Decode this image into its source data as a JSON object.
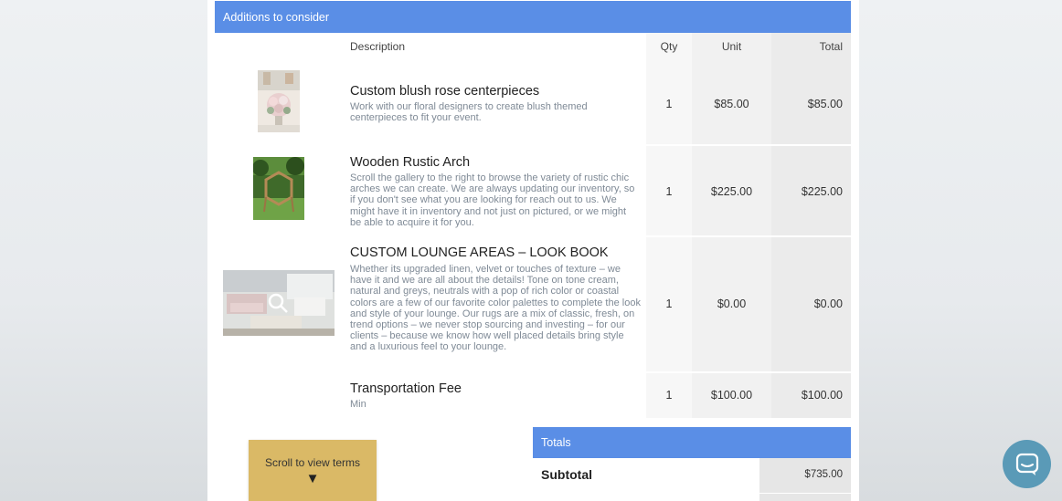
{
  "section": {
    "title": "Additions to consider"
  },
  "columns": {
    "description": "Description",
    "qty": "Qty",
    "unit": "Unit",
    "total": "Total"
  },
  "items": [
    {
      "thumbnail": "floral-centerpiece-photo",
      "title": "Custom blush rose centerpieces",
      "description": "Work with our floral designers to create blush themed centerpieces to fit your event.",
      "qty": "1",
      "unit": "$85.00",
      "total": "$85.00"
    },
    {
      "thumbnail": "wooden-arch-photo",
      "title": "Wooden Rustic Arch",
      "description": "Scroll the gallery to the right to browse the variety of rustic chic arches we can create. We are always updating our inventory, so if you don't see what you are looking for reach out to us. We might have it in inventory and not just on pictured, or we might be able to acquire it for you.",
      "qty": "1",
      "unit": "$225.00",
      "total": "$225.00"
    },
    {
      "thumbnail": "lounge-area-photo",
      "title": "CUSTOM LOUNGE AREAS – LOOK BOOK",
      "description": "Whether its upgraded linen, velvet or touches of texture – we have it and we are all about the details! Tone on tone cream, natural and greys, neutrals with a pop of rich color or coastal colors are a few of our favorite color palettes to complete the look and style of your lounge. Our rugs are a mix of classic, fresh, on trend options – we never stop sourcing and investing – for our clients – because we know how well placed details bring style and a luxurious feel to your lounge.",
      "qty": "1",
      "unit": "$0.00",
      "total": "$0.00"
    },
    {
      "title": "Transportation Fee",
      "description": "Min",
      "qty": "1",
      "unit": "$100.00",
      "total": "$100.00"
    }
  ],
  "totals": {
    "header": "Totals",
    "subtotal_label": "Subtotal",
    "subtotal_value": "$735.00"
  },
  "scroll_button": {
    "label": "Scroll to view terms",
    "icon": "down-triangle-icon"
  },
  "chat_button": {
    "icon": "chat-bubble-icon"
  },
  "colors": {
    "header_blue": "#5a8ee6",
    "button_gold": "#dab966",
    "chat_blue": "#5a9ab7"
  }
}
